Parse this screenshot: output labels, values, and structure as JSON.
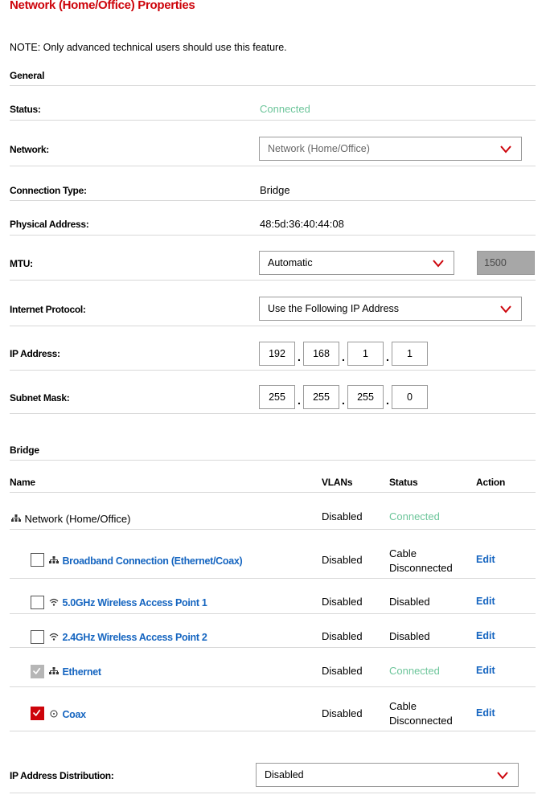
{
  "page": {
    "title": "Network (Home/Office) Properties",
    "note": "NOTE: Only advanced technical users should use this feature."
  },
  "general": {
    "heading": "General",
    "status_label": "Status:",
    "status_value": "Connected",
    "network_label": "Network:",
    "network_value": "Network (Home/Office)",
    "connection_type_label": "Connection Type:",
    "connection_type_value": "Bridge",
    "physical_address_label": "Physical Address:",
    "physical_address_value": "48:5d:36:40:44:08",
    "mtu_label": "MTU:",
    "mtu_mode": "Automatic",
    "mtu_value": "1500",
    "internet_protocol_label": "Internet Protocol:",
    "internet_protocol_value": "Use the Following IP Address",
    "ip_address_label": "IP Address:",
    "ip_address": [
      "192",
      "168",
      "1",
      "1"
    ],
    "subnet_mask_label": "Subnet Mask:",
    "subnet_mask": [
      "255",
      "255",
      "255",
      "0"
    ]
  },
  "bridge": {
    "heading": "Bridge",
    "columns": {
      "name": "Name",
      "vlans": "VLANs",
      "status": "Status",
      "action": "Action"
    },
    "parent": {
      "name": "Network (Home/Office)",
      "vlans": "Disabled",
      "status": "Connected"
    },
    "rows": [
      {
        "name": "Broadband Connection (Ethernet/Coax)",
        "icon": "network-icon",
        "vlans": "Disabled",
        "status_line1": "Cable",
        "status_line2": "Disconnected",
        "action": "Edit",
        "checked": false
      },
      {
        "name": "5.0GHz Wireless Access Point 1",
        "icon": "wifi-icon",
        "vlans": "Disabled",
        "status": "Disabled",
        "action": "Edit",
        "checked": false
      },
      {
        "name": "2.4GHz Wireless Access Point 2",
        "icon": "wifi-icon",
        "vlans": "Disabled",
        "status": "Disabled",
        "action": "Edit",
        "checked": false
      },
      {
        "name": "Ethernet",
        "icon": "network-icon",
        "vlans": "Disabled",
        "status": "Connected",
        "action": "Edit",
        "checked": true,
        "disabled": true
      },
      {
        "name": "Coax",
        "icon": "coax-icon",
        "vlans": "Disabled",
        "status_line1": "Cable",
        "status_line2": "Disconnected",
        "action": "Edit",
        "checked": true
      }
    ]
  },
  "ip_distribution": {
    "label": "IP Address Distribution:",
    "value": "Disabled"
  },
  "colors": {
    "accent_red": "#cd040b",
    "link_blue": "#1565c0",
    "connected_green": "#6cc59a"
  }
}
